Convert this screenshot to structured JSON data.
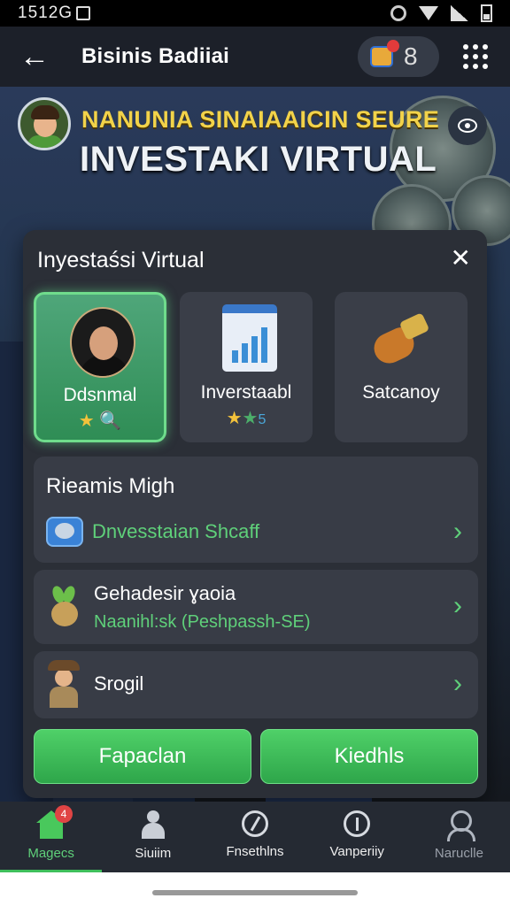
{
  "status_bar": {
    "time": "1512G"
  },
  "app_bar": {
    "title": "Bisinis Badiiai",
    "notification_count": "8"
  },
  "hero": {
    "subtitle": "NANUNIA SINAIAAICIN SEURE",
    "title": "INVESTAKI VIRTUAL"
  },
  "panel": {
    "title": "Inyestaśsi Virtual",
    "cards": [
      {
        "label": "Ddsnmal",
        "stars": "★",
        "extra": "🔍"
      },
      {
        "label": "Inverstaabl",
        "stars": "★",
        "extra": "★",
        "extra2": "5"
      },
      {
        "label": "Satcanoy"
      }
    ],
    "section": {
      "title": "Rieamis Migh",
      "link": "Dnvesstaian Shcaff"
    },
    "rows": [
      {
        "title": "Gehadesir ɣaoia",
        "subtitle": "Naanihl:sk (Peshpassh-SE)"
      },
      {
        "title": "Srogil"
      }
    ],
    "buttons": {
      "left": "Fapaclan",
      "right": "Kiedhls"
    }
  },
  "bottom_nav": [
    {
      "label": "Magecs",
      "badge": "4",
      "icon": "home-icon"
    },
    {
      "label": "Siuiim",
      "icon": "people-icon"
    },
    {
      "label": "Fnsethlns",
      "icon": "ring-icon"
    },
    {
      "label": "Vanperiiy",
      "icon": "info-icon"
    },
    {
      "label": "Naruclle",
      "icon": "user-icon"
    }
  ],
  "colors": {
    "accent": "#3fbf5c",
    "highlight": "#f2d34a",
    "panel": "#2b2f37"
  }
}
